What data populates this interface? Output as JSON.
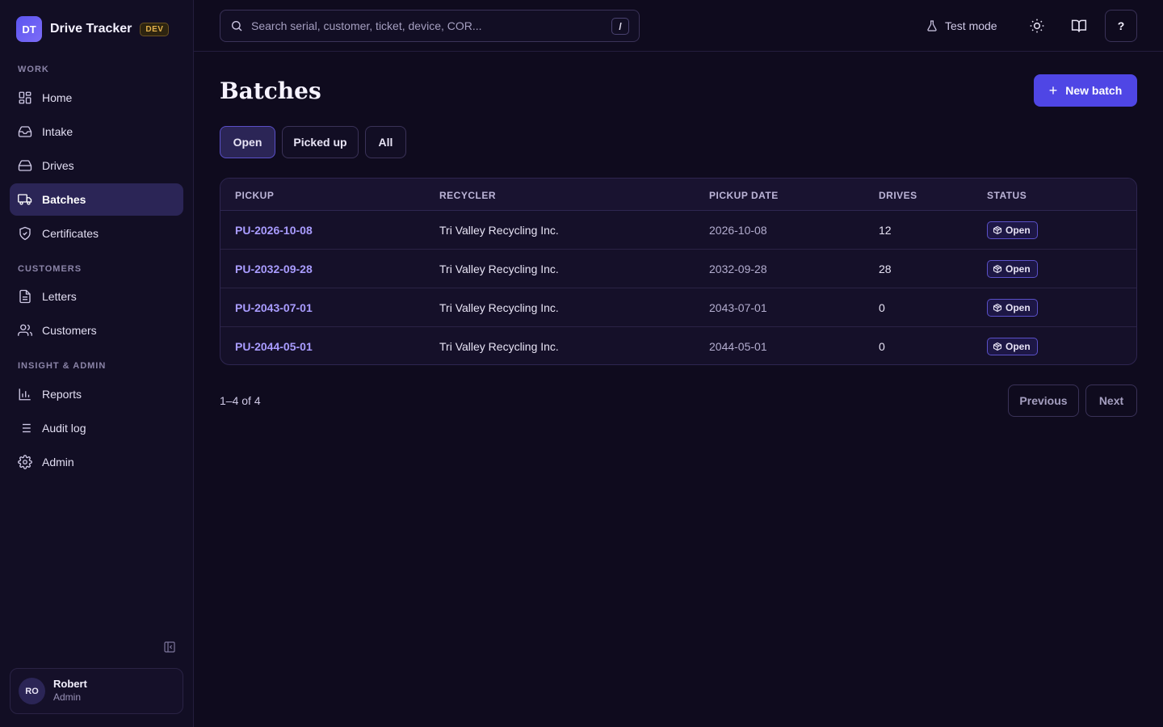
{
  "brand": {
    "logo": "DT",
    "name": "Drive Tracker",
    "env_badge": "DEV"
  },
  "sidebar": {
    "sections": [
      {
        "label": "WORK"
      },
      {
        "label": "CUSTOMERS"
      },
      {
        "label": "INSIGHT & ADMIN"
      }
    ],
    "items": [
      {
        "label": "Home",
        "icon": "grid-icon"
      },
      {
        "label": "Intake",
        "icon": "inbox-icon"
      },
      {
        "label": "Drives",
        "icon": "hard-drive-icon"
      },
      {
        "label": "Batches",
        "icon": "truck-icon",
        "active": true
      },
      {
        "label": "Certificates",
        "icon": "shield-check-icon"
      },
      {
        "label": "Letters",
        "icon": "file-text-icon"
      },
      {
        "label": "Customers",
        "icon": "users-icon"
      },
      {
        "label": "Reports",
        "icon": "bar-chart-icon"
      },
      {
        "label": "Audit log",
        "icon": "list-icon"
      },
      {
        "label": "Admin",
        "icon": "gear-icon"
      }
    ],
    "user": {
      "initials": "RO",
      "name": "Robert",
      "role": "Admin"
    }
  },
  "topbar": {
    "search_placeholder": "Search serial, customer, ticket, device, COR...",
    "search_shortcut": "/",
    "test_mode_label": "Test mode",
    "help_label": "?"
  },
  "main": {
    "title": "Batches",
    "new_button_label": "New batch",
    "filters": [
      {
        "label": "Open",
        "active": true
      },
      {
        "label": "Picked up"
      },
      {
        "label": "All"
      }
    ],
    "table": {
      "columns": [
        "PICKUP",
        "RECYCLER",
        "PICKUP DATE",
        "DRIVES",
        "STATUS"
      ],
      "rows": [
        {
          "pickup": "PU-2026-10-08",
          "recycler": "Tri Valley Recycling Inc.",
          "date": "2026-10-08",
          "drives": "12",
          "status": "Open"
        },
        {
          "pickup": "PU-2032-09-28",
          "recycler": "Tri Valley Recycling Inc.",
          "date": "2032-09-28",
          "drives": "28",
          "status": "Open"
        },
        {
          "pickup": "PU-2043-07-01",
          "recycler": "Tri Valley Recycling Inc.",
          "date": "2043-07-01",
          "drives": "0",
          "status": "Open"
        },
        {
          "pickup": "PU-2044-05-01",
          "recycler": "Tri Valley Recycling Inc.",
          "date": "2044-05-01",
          "drives": "0",
          "status": "Open"
        }
      ]
    },
    "pagination": {
      "summary": "1–4 of 4",
      "previous_label": "Previous",
      "next_label": "Next"
    }
  },
  "colors": {
    "accent": "#4f46e5",
    "link": "#a99cff",
    "background": "#0f0b1e",
    "badge_dev": "#e3b04b"
  }
}
